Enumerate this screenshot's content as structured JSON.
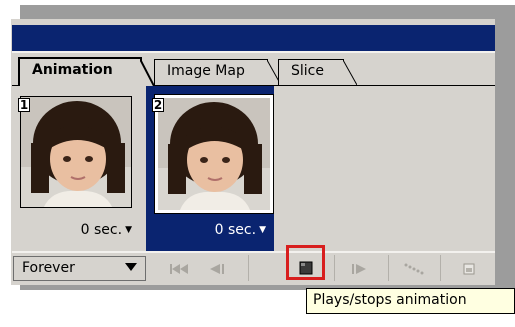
{
  "tabs": [
    {
      "label": "Animation"
    },
    {
      "label": "Image Map"
    },
    {
      "label": "Slice"
    }
  ],
  "frames": [
    {
      "number": "1",
      "delay": "0 sec.",
      "selected": false
    },
    {
      "number": "2",
      "delay": "0 sec.",
      "selected": true
    }
  ],
  "toolbar": {
    "loop_value": "Forever",
    "buttons": [
      {
        "icon": "rewind-to-first-icon"
      },
      {
        "icon": "previous-frame-icon"
      },
      {
        "icon": "play-stop-icon"
      },
      {
        "icon": "next-frame-icon"
      },
      {
        "icon": "tween-icon"
      },
      {
        "icon": "new-frame-icon"
      }
    ]
  },
  "tooltip": {
    "text": "Plays/stops animation"
  },
  "colors": {
    "title_bar": "#0a2470",
    "selection": "#0a2470",
    "panel": "#d6d3ce",
    "highlight": "#d81e1e",
    "tooltip_bg": "#ffffe1"
  }
}
